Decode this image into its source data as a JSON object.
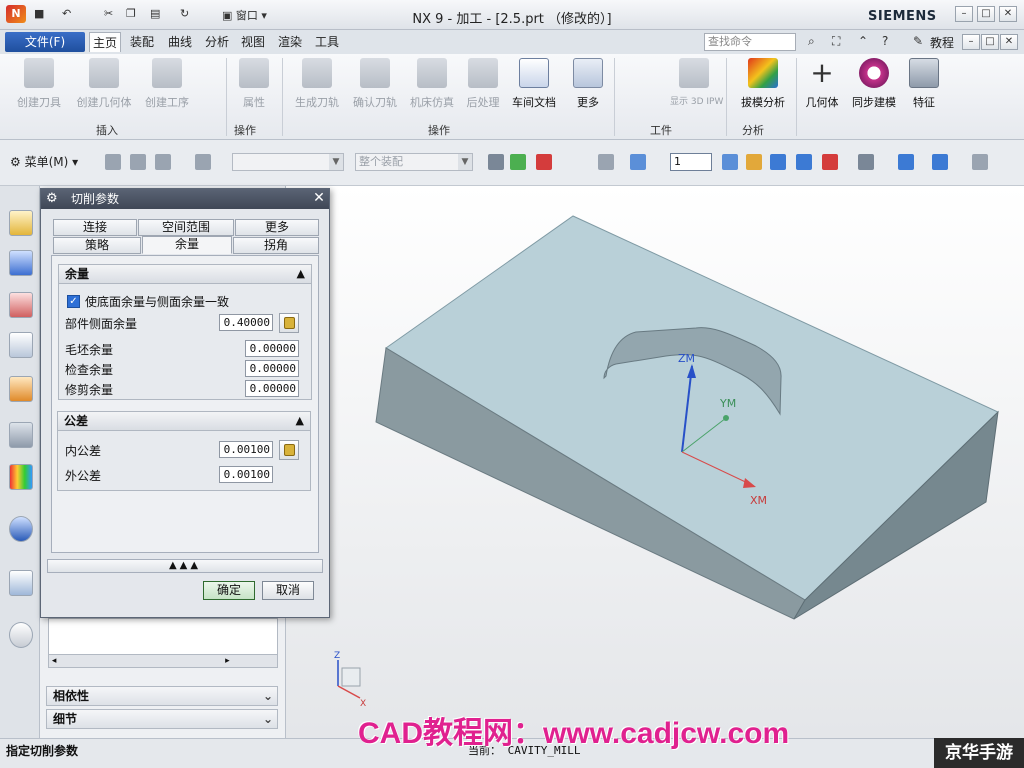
{
  "titlebar": {
    "title": "NX 9 - 加工 - [2.5.prt （修改的）]",
    "brand": "SIEMENS",
    "window_menu": "窗口"
  },
  "tabs": {
    "file": "文件(F)",
    "items": [
      "主页",
      "装配",
      "曲线",
      "分析",
      "视图",
      "渲染",
      "工具"
    ],
    "search_placeholder": "查找命令",
    "help": "教程"
  },
  "ribbon": {
    "insert": {
      "label": "插入",
      "buttons": [
        "创建刀具",
        "创建几何体",
        "创建工序"
      ]
    },
    "operation_small": {
      "label": "操作",
      "buttons": [
        "属性"
      ]
    },
    "operation": {
      "label": "操作",
      "buttons": [
        "生成刀轨",
        "确认刀轨",
        "机床仿真",
        "后处理",
        "车间文档",
        "更多"
      ]
    },
    "workpiece": {
      "label": "工件",
      "buttons": [
        "显示 3D IPW"
      ]
    },
    "analysis": {
      "label": "分析",
      "buttons": [
        "拔模分析"
      ]
    },
    "extra": {
      "buttons": [
        "几何体",
        "同步建模",
        "特征"
      ]
    }
  },
  "toolbar2": {
    "menu": "菜单(M)",
    "assembly_combo": "整个装配",
    "layer": "1"
  },
  "dialog": {
    "title": "切削参数",
    "tabs_row1": [
      "连接",
      "空间范围",
      "更多"
    ],
    "tabs_row2": [
      "策略",
      "余量",
      "拐角"
    ],
    "active_tab": "余量",
    "allowance": {
      "header": "余量",
      "checkbox_label": "使底面余量与侧面余量一致",
      "rows": [
        {
          "label": "部件侧面余量",
          "value": "0.40000"
        },
        {
          "label": "毛坯余量",
          "value": "0.00000"
        },
        {
          "label": "检查余量",
          "value": "0.00000"
        },
        {
          "label": "修剪余量",
          "value": "0.00000"
        }
      ]
    },
    "tolerance": {
      "header": "公差",
      "rows": [
        {
          "label": "内公差",
          "value": "0.00100"
        },
        {
          "label": "外公差",
          "value": "0.00100"
        }
      ]
    },
    "ok": "确定",
    "cancel": "取消"
  },
  "navigator": {
    "sections": [
      "相依性",
      "细节"
    ]
  },
  "axes": {
    "zm": "ZM",
    "ym": "YM",
    "xm": "XM",
    "triad_z": "Z",
    "triad_x": "X"
  },
  "status": {
    "left": "指定切削参数",
    "current_label": "当前：",
    "current_value": "CAVITY_MILL"
  },
  "watermark": "CAD教程网：www.cadjcw.com",
  "corner_watermark": "京华手游",
  "colors": {
    "accent": "#1f4f9e",
    "part_top": "#b9d0d8",
    "part_side": "#8a9aa0",
    "watermark": "#e0218f"
  }
}
